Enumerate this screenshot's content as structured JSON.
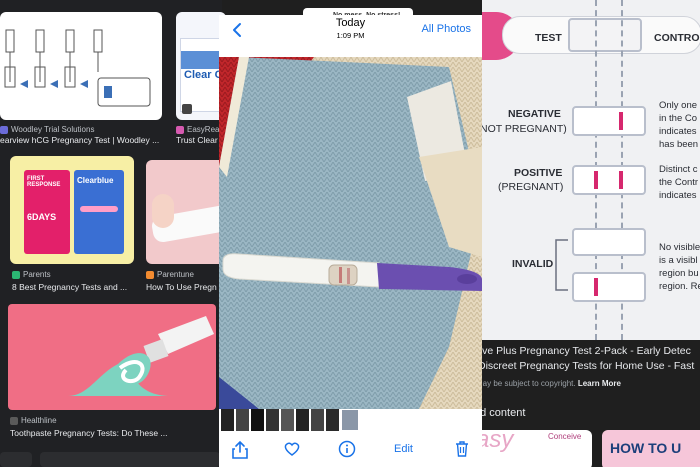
{
  "left_grid": {
    "row1": {
      "source": "Woodley Trial Solutions",
      "title": "earview hCG Pregnancy Test | Woodley ...",
      "source2": "EasyReach",
      "title2": "Trust Clear"
    },
    "product_box_label": "Clear C",
    "row2": {
      "source": "Parents",
      "title": "8 Best Pregnancy Tests and ...",
      "source2": "Parentune",
      "title2": "How To Use Pregn"
    },
    "box_first_response": "FIRST RESPONSE",
    "box_6days": "6DAYS",
    "box_clearblue": "Clearblue",
    "row3": {
      "source": "Healthline",
      "title": "Toothpaste Pregnancy Tests: Do These ..."
    },
    "top_right_ad": "No mess. No stress!"
  },
  "phone": {
    "date": "Today",
    "time": "1:09 PM",
    "all_photos": "All Photos",
    "edit": "Edit"
  },
  "right_panel": {
    "col_test": "TEST",
    "col_control": "CONTRO",
    "negative": "NEGATIVE",
    "negative_sub": "NOT PREGNANT)",
    "negative_desc": [
      "Only one",
      "in the Co",
      "indicates",
      "has been"
    ],
    "positive": "POSITIVE",
    "positive_sub": "(PREGNANT)",
    "positive_desc": [
      "Distinct c",
      "the Contr",
      "indicates"
    ],
    "invalid": "INVALID",
    "invalid_desc": [
      "No visible",
      "is a visibl",
      "region bu",
      "region. Re"
    ],
    "caption1": "eive Plus Pregnancy Test 2-Pack - Early Detec",
    "caption2": "Discreet Pregnancy Tests for Home Use - Fast",
    "copyright": "May be subject to copyright.",
    "learn_more": "Learn More",
    "related": "ed content",
    "thumb_easy": "asy",
    "thumb_conceive": "Conceive",
    "thumb_howto": "HOW TO U"
  },
  "colors": {
    "accent_blue": "#1a73e8",
    "line_pink": "#d6286e",
    "bg_dark": "#202124"
  }
}
